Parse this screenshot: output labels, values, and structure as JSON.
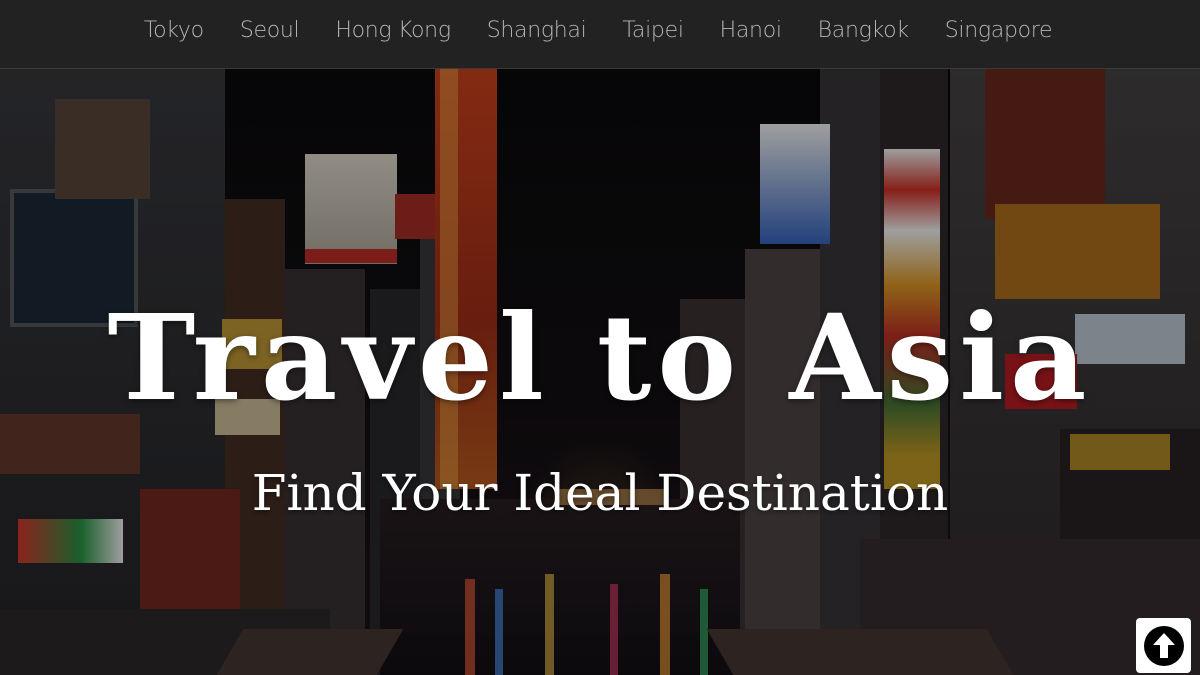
{
  "nav": {
    "items": [
      {
        "label": "Tokyo"
      },
      {
        "label": "Seoul"
      },
      {
        "label": "Hong Kong"
      },
      {
        "label": "Shanghai"
      },
      {
        "label": "Taipei"
      },
      {
        "label": "Hanoi"
      },
      {
        "label": "Bangkok"
      },
      {
        "label": "Singapore"
      }
    ]
  },
  "hero": {
    "title": "Travel to Asia",
    "subtitle": "Find Your Ideal Destination",
    "image_description_icon": "night-city-photo"
  },
  "scroll_button": {
    "icon": "arrow-up-circle-icon"
  },
  "colors": {
    "navbar_bg": "#222222",
    "nav_text": "#b5b5b5",
    "hero_text": "#ffffff"
  }
}
